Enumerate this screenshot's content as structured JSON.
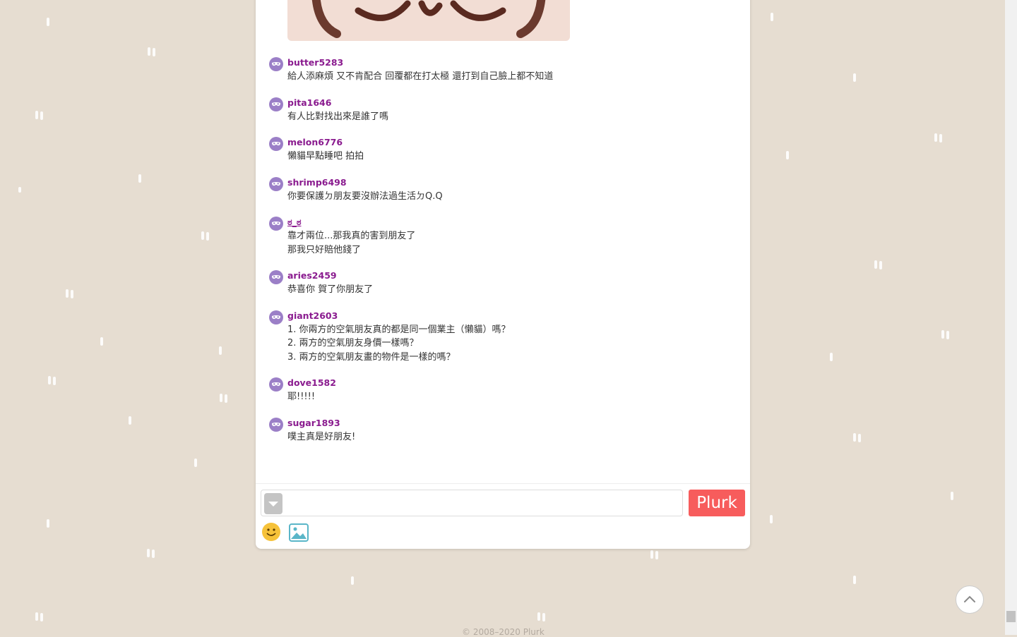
{
  "responses": [
    {
      "user": "butter5283",
      "lines": [
        "給人添麻煩 又不肯配合 回覆都在打太極 還打到自己臉上都不知道"
      ]
    },
    {
      "user": "pita1646",
      "lines": [
        "有人比對找出來是誰了嗎"
      ]
    },
    {
      "user": "melon6776",
      "lines": [
        "懶貓早點睡吧 拍拍"
      ]
    },
    {
      "user": "shrimp6498",
      "lines": [
        "你要保護ㄉ朋友要沒辦法過生活ㄉQ.Q"
      ]
    },
    {
      "user": "ಠ_ಠ",
      "lines": [
        "靠才兩位...那我真的害到朋友了",
        "那我只好賠他錢了"
      ],
      "underline": true
    },
    {
      "user": "aries2459",
      "lines": [
        "恭喜你 賀了你朋友了"
      ]
    },
    {
      "user": "giant2603",
      "lines": [
        "1. 你兩方的空氣朋友真的都是同一個業主（懶貓）嗎？",
        "2. 兩方的空氣朋友身價一樣嗎？",
        "3. 兩方的空氣朋友畫的物件是一樣的嗎？"
      ]
    },
    {
      "user": "dove1582",
      "lines": [
        "耶!!!!!"
      ]
    },
    {
      "user": "sugar1893",
      "lines": [
        "噗主真是好朋友!"
      ]
    }
  ],
  "input": {
    "placeholder": "",
    "submit_label": "Plurk"
  },
  "footer": {
    "copyright": "© 2008–2020 Plurk"
  },
  "icons": {
    "avatar": "mask-icon",
    "qualifier": "chevron-down-icon",
    "emoji": "smiley-icon",
    "image": "image-icon",
    "scroll_top": "chevron-up-icon"
  },
  "colors": {
    "username": "#8a1b8f",
    "submit": "#f75c5c",
    "background": "#e6ddd1",
    "avatar": "#9b7fc7"
  }
}
